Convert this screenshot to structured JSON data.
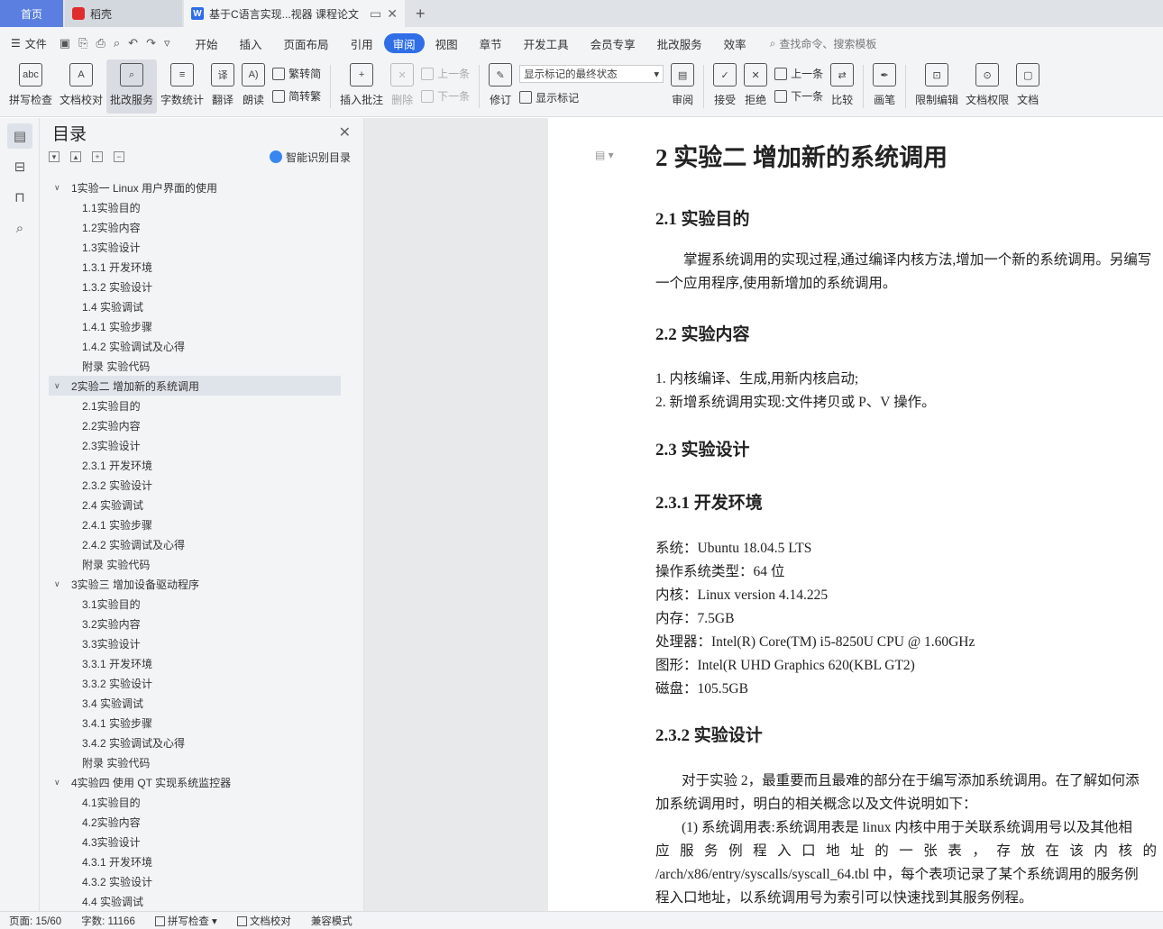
{
  "tabs": {
    "home": "首页",
    "tab1": "稻壳",
    "tab2": "基于C语言实现...视器 课程论文"
  },
  "menu": {
    "file": "文件",
    "items": [
      "开始",
      "插入",
      "页面布局",
      "引用",
      "审阅",
      "视图",
      "章节",
      "开发工具",
      "会员专享",
      "批改服务",
      "效率"
    ],
    "active_index": 4,
    "search": "查找命令、搜索模板"
  },
  "ribbon": {
    "spellcheck": "拼写检查",
    "doccheck": "文档校对",
    "revise_service": "批改服务",
    "wordcount": "字数统计",
    "translate": "翻译",
    "read": "朗读",
    "trad_to_simp": "繁转简",
    "simp_to_trad": "简转繁",
    "insert_comment": "插入批注",
    "delete": "删除",
    "prev": "上一条",
    "next": "下一条",
    "revise": "修订",
    "markup_select": "显示标记的最终状态",
    "show_markup": "显示标记",
    "review": "审阅",
    "accept": "接受",
    "reject": "拒绝",
    "prev2": "上一条",
    "next2": "下一条",
    "compare": "比较",
    "pen": "画笔",
    "restrict": "限制编辑",
    "permission": "文档权限",
    "doc_more": "文档"
  },
  "toc": {
    "title": "目录",
    "ai": "智能识别目录",
    "items": [
      {
        "level": 1,
        "text": "1实验一  Linux 用户界面的使用"
      },
      {
        "level": 2,
        "text": "1.1实验目的"
      },
      {
        "level": 2,
        "text": "1.2实验内容"
      },
      {
        "level": 2,
        "text": "1.3实验设计"
      },
      {
        "level": 2,
        "text": "1.3.1  开发环境"
      },
      {
        "level": 2,
        "text": "1.3.2  实验设计"
      },
      {
        "level": 2,
        "text": "1.4  实验调试"
      },
      {
        "level": 2,
        "text": "1.4.1  实验步骤"
      },
      {
        "level": 2,
        "text": "1.4.2  实验调试及心得"
      },
      {
        "level": 2,
        "text": "附录  实验代码"
      },
      {
        "level": 1,
        "text": "2实验二  增加新的系统调用",
        "selected": true
      },
      {
        "level": 2,
        "text": "2.1实验目的"
      },
      {
        "level": 2,
        "text": "2.2实验内容"
      },
      {
        "level": 2,
        "text": "2.3实验设计"
      },
      {
        "level": 2,
        "text": "2.3.1  开发环境"
      },
      {
        "level": 2,
        "text": "2.3.2  实验设计"
      },
      {
        "level": 2,
        "text": "2.4  实验调试"
      },
      {
        "level": 2,
        "text": "2.4.1  实验步骤"
      },
      {
        "level": 2,
        "text": "2.4.2  实验调试及心得"
      },
      {
        "level": 2,
        "text": "附录  实验代码"
      },
      {
        "level": 1,
        "text": "3实验三  增加设备驱动程序"
      },
      {
        "level": 2,
        "text": "3.1实验目的"
      },
      {
        "level": 2,
        "text": "3.2实验内容"
      },
      {
        "level": 2,
        "text": "3.3实验设计"
      },
      {
        "level": 2,
        "text": "3.3.1  开发环境"
      },
      {
        "level": 2,
        "text": "3.3.2  实验设计"
      },
      {
        "level": 2,
        "text": "3.4  实验调试"
      },
      {
        "level": 2,
        "text": "3.4.1  实验步骤"
      },
      {
        "level": 2,
        "text": "3.4.2  实验调试及心得"
      },
      {
        "level": 2,
        "text": "附录  实验代码"
      },
      {
        "level": 1,
        "text": "4实验四  使用 QT 实现系统监控器"
      },
      {
        "level": 2,
        "text": "4.1实验目的"
      },
      {
        "level": 2,
        "text": "4.2实验内容"
      },
      {
        "level": 2,
        "text": "4.3实验设计"
      },
      {
        "level": 2,
        "text": "4.3.1  开发环境"
      },
      {
        "level": 2,
        "text": "4.3.2  实验设计"
      },
      {
        "level": 2,
        "text": "4.4  实验调试"
      }
    ]
  },
  "doc": {
    "h1": "2  实验二  增加新的系统调用",
    "h2_1": "2.1 实验目的",
    "p1": "掌握系统调用的实现过程,通过编译内核方法,增加一个新的系统调用。另编写一个应用程序,使用新增加的系统调用。",
    "h2_2": "2.2 实验内容",
    "li1": "1.  内核编译、生成,用新内核启动;",
    "li2": "2.  新增系统调用实现:文件拷贝或 P、V 操作。",
    "h2_3": "2.3 实验设计",
    "h2_4": "2.3.1   开发环境",
    "env": [
      "系统：Ubuntu 18.04.5 LTS",
      "操作系统类型：64 位",
      "内核：Linux version 4.14.225",
      "内存：7.5GB",
      "处理器：Intel(R) Core(TM) i5-8250U CPU @ 1.60GHz",
      "图形：Intel(R UHD Graphics 620(KBL GT2)",
      "磁盘：105.5GB"
    ],
    "h2_5": "2.3.2   实验设计",
    "p2a": "对于实验 2，最重要而且最难的部分在于编写添加系统调用。在了解如何添",
    "p2b": "加系统调用时，明白的相关概念以及文件说明如下：",
    "p3a": "(1)  系统调用表:系统调用表是 linux 内核中用于关联系统调用号以及其他相",
    "p3b": "应 服 务 例 程 入 口 地 址 的 一 张 表 ， 存 放 在 该 内 核 的",
    "p3c": "/arch/x86/entry/syscalls/syscall_64.tbl 中，每个表项记录了某个系统调用的服务例",
    "p3d": "程入口地址，以系统调用号为索引可以快速找到其服务例程。"
  },
  "status": {
    "page": "页面: 15/60",
    "words": "字数: 11166",
    "spell": "拼写检查",
    "proof": "文档校对",
    "compat": "兼容模式"
  }
}
